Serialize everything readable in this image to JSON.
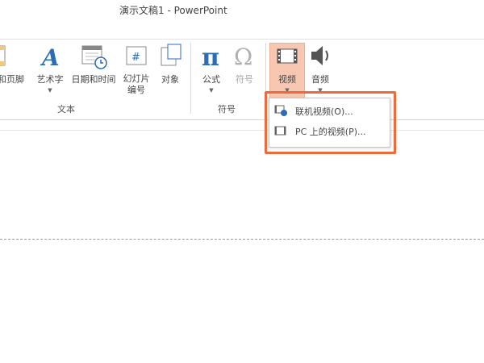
{
  "window": {
    "title": "演示文稿1 - PowerPoint"
  },
  "ribbon": {
    "text_group": {
      "label": "文本",
      "items": [
        {
          "label": "页眉和页脚",
          "visible_label": "眉和页脚",
          "icon": "header-footer-icon"
        },
        {
          "label": "艺术字",
          "icon": "wordart-icon",
          "caret": "▼"
        },
        {
          "label": "日期和时间",
          "icon": "date-time-icon"
        },
        {
          "label": "幻灯片",
          "label2": "编号",
          "icon": "slide-number-icon"
        },
        {
          "label": "对象",
          "icon": "object-icon"
        }
      ]
    },
    "symbol_group": {
      "label": "符号",
      "items": [
        {
          "label": "公式",
          "icon": "pi-equation-icon",
          "caret": "▼"
        },
        {
          "label": "符号",
          "icon": "omega-symbol-icon",
          "disabled": true
        }
      ]
    },
    "media_group": {
      "items": [
        {
          "label": "视频",
          "icon": "video-icon",
          "caret": "▼",
          "active": true
        },
        {
          "label": "音频",
          "icon": "audio-icon",
          "caret": "▼"
        }
      ]
    }
  },
  "video_menu": {
    "items": [
      {
        "label": "联机视频(O)...",
        "icon": "online-video-icon"
      },
      {
        "label": "PC 上的视频(P)...",
        "icon": "pc-video-icon"
      }
    ]
  },
  "colors": {
    "highlight_border": "#ef6a3b",
    "active_button": "#f7c7b2",
    "accent_blue": "#2b6cb5"
  }
}
